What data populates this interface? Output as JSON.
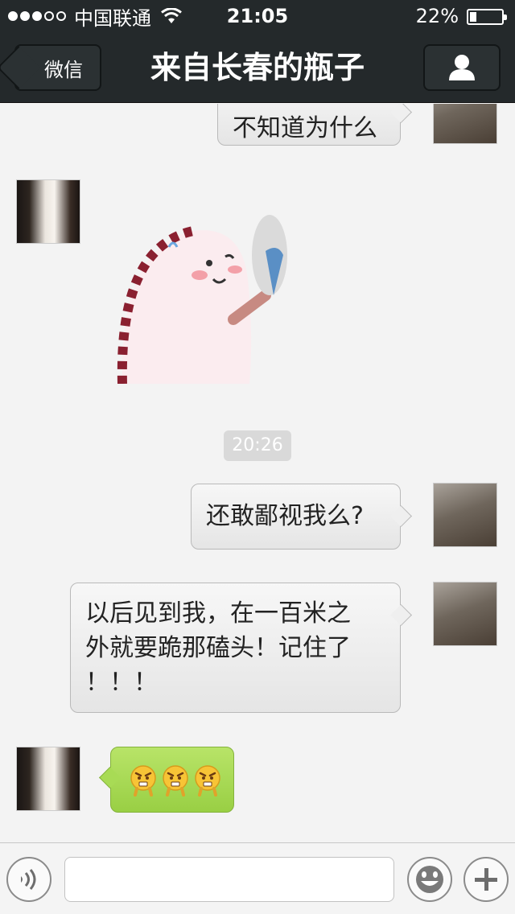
{
  "status_bar": {
    "carrier": "中国联通",
    "time": "21:05",
    "battery_percent": "22%",
    "battery_level": 0.22,
    "signal_bars_filled": 3,
    "signal_bars_total": 5
  },
  "nav": {
    "back_label": "微信",
    "title": "来自长春的瓶子",
    "profile_icon": "person-icon"
  },
  "messages": [
    {
      "sender": "self",
      "type": "text",
      "text": "不知道为什么"
    },
    {
      "sender": "other",
      "type": "sticker",
      "sticker_icon": "dinosaur-fan-sticker"
    },
    {
      "type": "timestamp",
      "text": "20:26"
    },
    {
      "sender": "self",
      "type": "text",
      "text": "还敢鄙视我么?"
    },
    {
      "sender": "self",
      "type": "text",
      "lines": [
        "以后见到我，在一百米之",
        "外就要跪那磕头！记住了",
        "！！！"
      ]
    },
    {
      "sender": "other",
      "type": "emoji",
      "emoji_icon": "angry-emoji",
      "count": 3
    }
  ],
  "input_bar": {
    "voice_icon": "voice-icon",
    "text_value": "",
    "emoji_icon": "smiley-icon",
    "add_icon": "plus-icon"
  },
  "colors": {
    "nav_bg": "#24292b",
    "chat_bg": "#f3f3f3",
    "bubble_self": "#ececec",
    "bubble_other": "#a8db55"
  }
}
